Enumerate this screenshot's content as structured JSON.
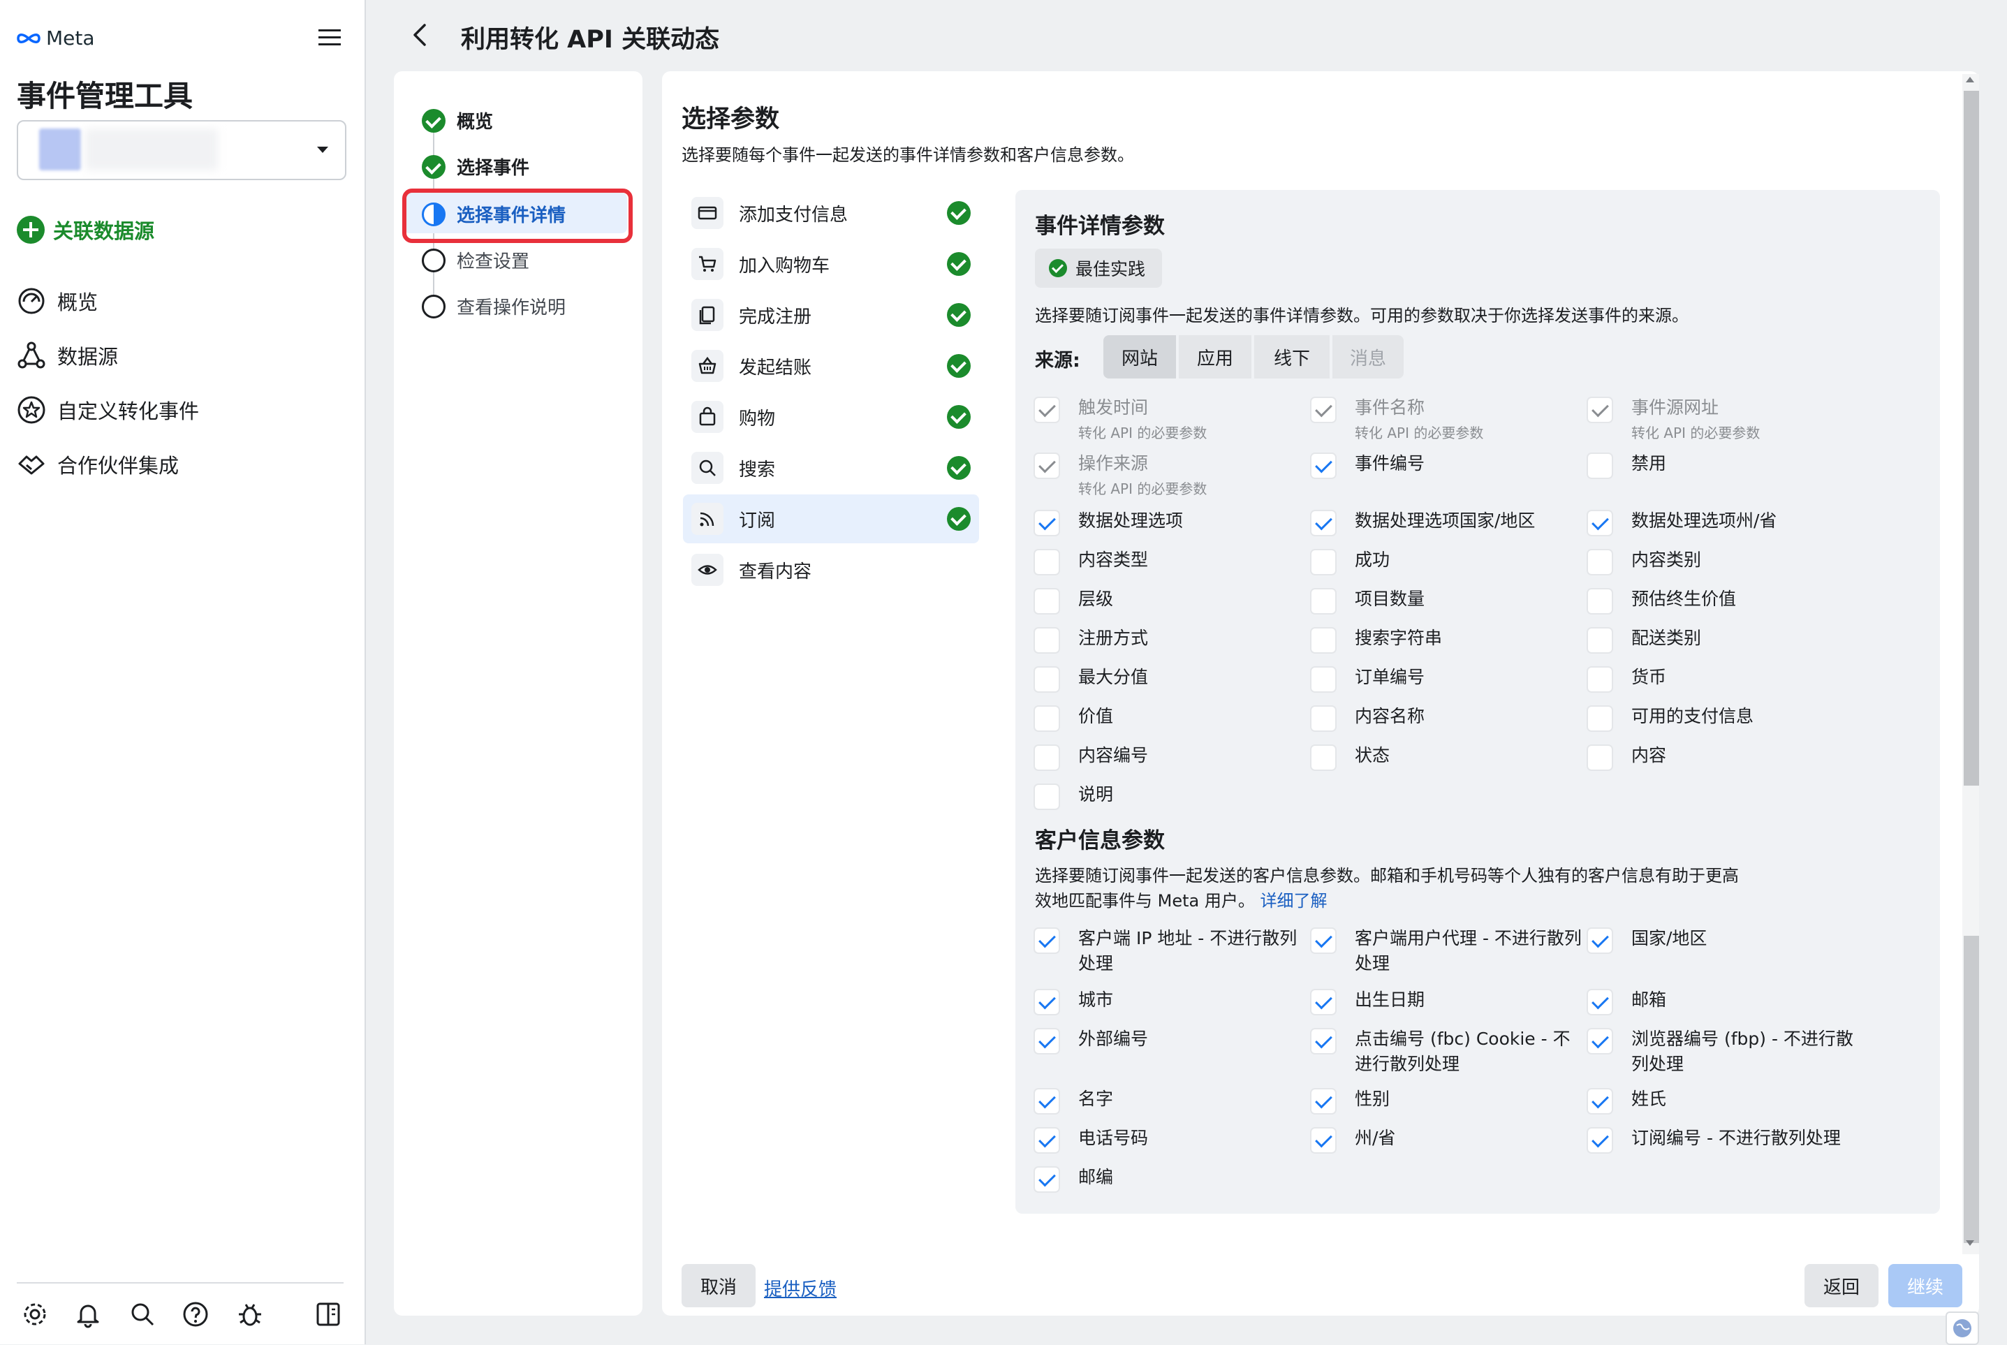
{
  "sidebar": {
    "brand": "Meta",
    "title": "事件管理工具",
    "connect_label": "关联数据源",
    "nav": [
      {
        "label": "概览",
        "icon": "gauge-icon"
      },
      {
        "label": "数据源",
        "icon": "nodes-icon"
      },
      {
        "label": "自定义转化事件",
        "icon": "star-badge-icon"
      },
      {
        "label": "合作伙伴集成",
        "icon": "handshake-icon"
      }
    ],
    "bottom_icons": [
      "gear-icon",
      "bell-icon",
      "search-icon",
      "help-icon",
      "bug-icon",
      "panel-toggle-icon"
    ]
  },
  "header": {
    "title": "利用转化 API 关联动态"
  },
  "steps": [
    {
      "label": "概览",
      "state": "done"
    },
    {
      "label": "选择事件",
      "state": "done"
    },
    {
      "label": "选择事件详情",
      "state": "current"
    },
    {
      "label": "检查设置",
      "state": "todo"
    },
    {
      "label": "查看操作说明",
      "state": "todo"
    }
  ],
  "main": {
    "title": "选择参数",
    "description": "选择要随每个事件一起发送的事件详情参数和客户信息参数。",
    "events": [
      {
        "label": "添加支付信息",
        "icon": "credit-card-icon",
        "done": true
      },
      {
        "label": "加入购物车",
        "icon": "cart-icon",
        "done": true
      },
      {
        "label": "完成注册",
        "icon": "document-icon",
        "done": true
      },
      {
        "label": "发起结账",
        "icon": "basket-icon",
        "done": true
      },
      {
        "label": "购物",
        "icon": "shopping-bag-icon",
        "done": true
      },
      {
        "label": "搜索",
        "icon": "search-icon",
        "done": true
      },
      {
        "label": "订阅",
        "icon": "rss-icon",
        "done": true,
        "active": true
      },
      {
        "label": "查看内容",
        "icon": "eye-icon",
        "done": false
      }
    ],
    "event_params": {
      "title": "事件详情参数",
      "badge": "最佳实践",
      "description": "选择要随订阅事件一起发送的事件详情参数。可用的参数取决于你选择发送事件的来源。",
      "source_label": "来源:",
      "sources": [
        {
          "label": "网站",
          "state": "selected"
        },
        {
          "label": "应用",
          "state": "normal"
        },
        {
          "label": "线下",
          "state": "normal"
        },
        {
          "label": "消息",
          "state": "disabled"
        }
      ],
      "required_note": "转化 API 的必要参数",
      "params": [
        {
          "label": "触发时间",
          "checked": true,
          "locked": true
        },
        {
          "label": "事件名称",
          "checked": true,
          "locked": true
        },
        {
          "label": "事件源网址",
          "checked": true,
          "locked": true
        },
        {
          "label": "操作来源",
          "checked": true,
          "locked": true
        },
        {
          "label": "事件编号",
          "checked": true
        },
        {
          "label": "禁用",
          "checked": false
        },
        {
          "label": "数据处理选项",
          "checked": true
        },
        {
          "label": "数据处理选项国家/地区",
          "checked": true
        },
        {
          "label": "数据处理选项州/省",
          "checked": true
        },
        {
          "label": "内容类型",
          "checked": false
        },
        {
          "label": "成功",
          "checked": false
        },
        {
          "label": "内容类别",
          "checked": false
        },
        {
          "label": "层级",
          "checked": false
        },
        {
          "label": "项目数量",
          "checked": false
        },
        {
          "label": "预估终生价值",
          "checked": false
        },
        {
          "label": "注册方式",
          "checked": false
        },
        {
          "label": "搜索字符串",
          "checked": false
        },
        {
          "label": "配送类别",
          "checked": false
        },
        {
          "label": "最大分值",
          "checked": false
        },
        {
          "label": "订单编号",
          "checked": false
        },
        {
          "label": "货币",
          "checked": false
        },
        {
          "label": "价值",
          "checked": false
        },
        {
          "label": "内容名称",
          "checked": false
        },
        {
          "label": "可用的支付信息",
          "checked": false
        },
        {
          "label": "内容编号",
          "checked": false
        },
        {
          "label": "状态",
          "checked": false
        },
        {
          "label": "内容",
          "checked": false
        },
        {
          "label": "说明",
          "checked": false
        }
      ]
    },
    "customer_params": {
      "title": "客户信息参数",
      "description": "选择要随订阅事件一起发送的客户信息参数。邮箱和手机号码等个人独有的客户信息有助于更高效地匹配事件与 Meta 用户。",
      "learn_more": "详细了解",
      "params": [
        {
          "label": "客户端 IP 地址 - 不进行散列处理",
          "checked": true
        },
        {
          "label": "客户端用户代理 - 不进行散列处理",
          "checked": true
        },
        {
          "label": "国家/地区",
          "checked": true
        },
        {
          "label": "城市",
          "checked": true
        },
        {
          "label": "出生日期",
          "checked": true
        },
        {
          "label": "邮箱",
          "checked": true
        },
        {
          "label": "外部编号",
          "checked": true
        },
        {
          "label": "点击编号 (fbc) Cookie - 不进行散列处理",
          "checked": true
        },
        {
          "label": "浏览器编号 (fbp) - 不进行散列处理",
          "checked": true
        },
        {
          "label": "名字",
          "checked": true
        },
        {
          "label": "性别",
          "checked": true
        },
        {
          "label": "姓氏",
          "checked": true
        },
        {
          "label": "电话号码",
          "checked": true
        },
        {
          "label": "州/省",
          "checked": true
        },
        {
          "label": "订阅编号 - 不进行散列处理",
          "checked": true
        },
        {
          "label": "邮编",
          "checked": true
        }
      ]
    },
    "footer": {
      "cancel": "取消",
      "feedback": "提供反馈",
      "back": "返回",
      "continue": "继续"
    }
  },
  "colors": {
    "accent": "#1877f2",
    "success": "#1b8b2c",
    "highlight": "#e8303b"
  }
}
